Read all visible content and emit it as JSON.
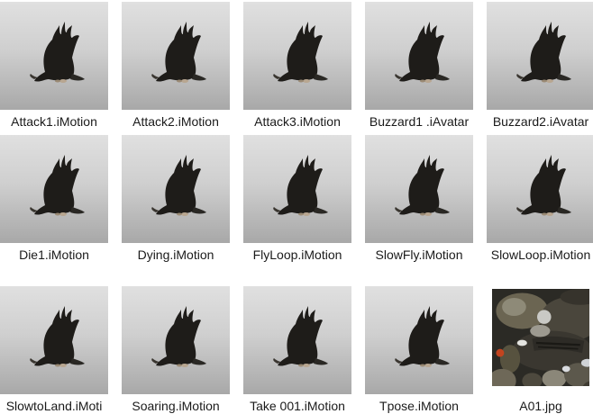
{
  "explorer": {
    "files": [
      {
        "name": "Attack1.iMotion",
        "thumbnail": "eagle-icon"
      },
      {
        "name": "Attack2.iMotion",
        "thumbnail": "eagle-icon"
      },
      {
        "name": "Attack3.iMotion",
        "thumbnail": "eagle-icon"
      },
      {
        "name": "Buzzard1 .iAvatar",
        "thumbnail": "eagle-icon"
      },
      {
        "name": "Buzzard2.iAvatar",
        "thumbnail": "eagle-icon"
      },
      {
        "name": "Die1.iMotion",
        "thumbnail": "eagle-icon"
      },
      {
        "name": "Dying.iMotion",
        "thumbnail": "eagle-icon"
      },
      {
        "name": "FlyLoop.iMotion",
        "thumbnail": "eagle-icon"
      },
      {
        "name": "SlowFly.iMotion",
        "thumbnail": "eagle-icon"
      },
      {
        "name": "SlowLoop.iMotion",
        "thumbnail": "eagle-icon"
      },
      {
        "name": "SlowtoLand.iMoti",
        "thumbnail": "eagle-icon"
      },
      {
        "name": "Soaring.iMotion",
        "thumbnail": "eagle-icon"
      },
      {
        "name": "Take 001.iMotion",
        "thumbnail": "eagle-icon"
      },
      {
        "name": "Tpose.iMotion",
        "thumbnail": "eagle-icon"
      },
      {
        "name": "A01.jpg",
        "thumbnail": "texture-image"
      }
    ]
  },
  "colors": {
    "label_text": "#1a1a1a",
    "thumb_top": "#e0e0e0",
    "thumb_bottom": "#a8a8a8",
    "bird": "#1e1c19"
  }
}
